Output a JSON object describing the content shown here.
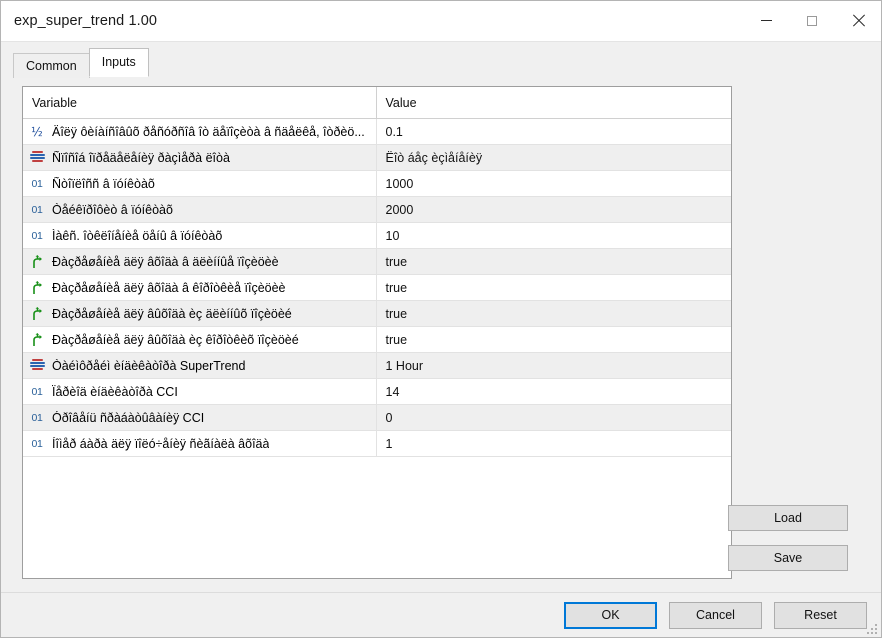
{
  "window": {
    "title": "exp_super_trend 1.00",
    "controls": {
      "minimize": "minimize-icon",
      "maximize": "maximize-icon",
      "close": "close-icon"
    }
  },
  "tabs": [
    {
      "label": "Common",
      "active": false
    },
    {
      "label": "Inputs",
      "active": true
    }
  ],
  "table": {
    "headers": {
      "variable": "Variable",
      "value": "Value"
    },
    "rows": [
      {
        "icon": "double-type-icon",
        "icon_glyph": "½",
        "variable": "Äîëÿ ôèíàíñîâûõ ðåñóðñîâ îò äåïîçèòà â ñäåëêå, îòðèö...",
        "value": "0.1"
      },
      {
        "icon": "enum-type-icon",
        "icon_glyph": "",
        "variable": "Ñïîñîá îïðåäåëåíèÿ ðàçìåðà ëîòà",
        "value": "Ëîò áåç èçìåíåíèÿ"
      },
      {
        "icon": "int-type-icon",
        "icon_glyph": "01",
        "variable": "Ñòîïëîññ â ïóíêòàõ",
        "value": "1000"
      },
      {
        "icon": "int-type-icon",
        "icon_glyph": "01",
        "variable": "Òåéêïðîôèò â ïóíêòàõ",
        "value": "2000"
      },
      {
        "icon": "int-type-icon",
        "icon_glyph": "01",
        "variable": "Ìàêñ. îòêëîíåíèå öåíû â ïóíêòàõ",
        "value": "10"
      },
      {
        "icon": "bool-type-icon",
        "icon_glyph": "",
        "variable": "Ðàçðåøåíèå äëÿ âõîäà â äëèííûå ïîçèöèè",
        "value": "true"
      },
      {
        "icon": "bool-type-icon",
        "icon_glyph": "",
        "variable": "Ðàçðåøåíèå äëÿ âõîäà â êîðîòêèå ïîçèöèè",
        "value": "true"
      },
      {
        "icon": "bool-type-icon",
        "icon_glyph": "",
        "variable": "Ðàçðåøåíèå äëÿ âûõîäà èç äëèííûõ ïîçèöèé",
        "value": "true"
      },
      {
        "icon": "bool-type-icon",
        "icon_glyph": "",
        "variable": "Ðàçðåøåíèå äëÿ âûõîäà èç êîðîòêèõ ïîçèöèé",
        "value": "true"
      },
      {
        "icon": "enum-type-icon",
        "icon_glyph": "",
        "variable": "Òàéìôðåéì èíäèêàòîðà SuperTrend",
        "value": "1 Hour"
      },
      {
        "icon": "int-type-icon",
        "icon_glyph": "01",
        "variable": "Ïåðèîä èíäèêàòîðà CCI",
        "value": "14"
      },
      {
        "icon": "int-type-icon",
        "icon_glyph": "01",
        "variable": "Óðîâåíü ñðàáàòûâàíèÿ CCI",
        "value": "0"
      },
      {
        "icon": "int-type-icon",
        "icon_glyph": "01",
        "variable": "Íîìåð áàðà äëÿ ïîëó÷åíèÿ ñèãíàëà âõîäà",
        "value": "1"
      }
    ]
  },
  "side_buttons": {
    "load": "Load",
    "save": "Save"
  },
  "footer_buttons": {
    "ok": "OK",
    "cancel": "Cancel",
    "reset": "Reset"
  },
  "colors": {
    "accent": "#0078d7",
    "window_bg": "#f0f0f0",
    "grid_alt_row": "#efefef",
    "int_icon": "#2a6099",
    "double_icon": "#1f4e9c",
    "bool_icon": "#189018",
    "enum_icon_blue": "#2a64b0",
    "enum_icon_red": "#c04040"
  }
}
